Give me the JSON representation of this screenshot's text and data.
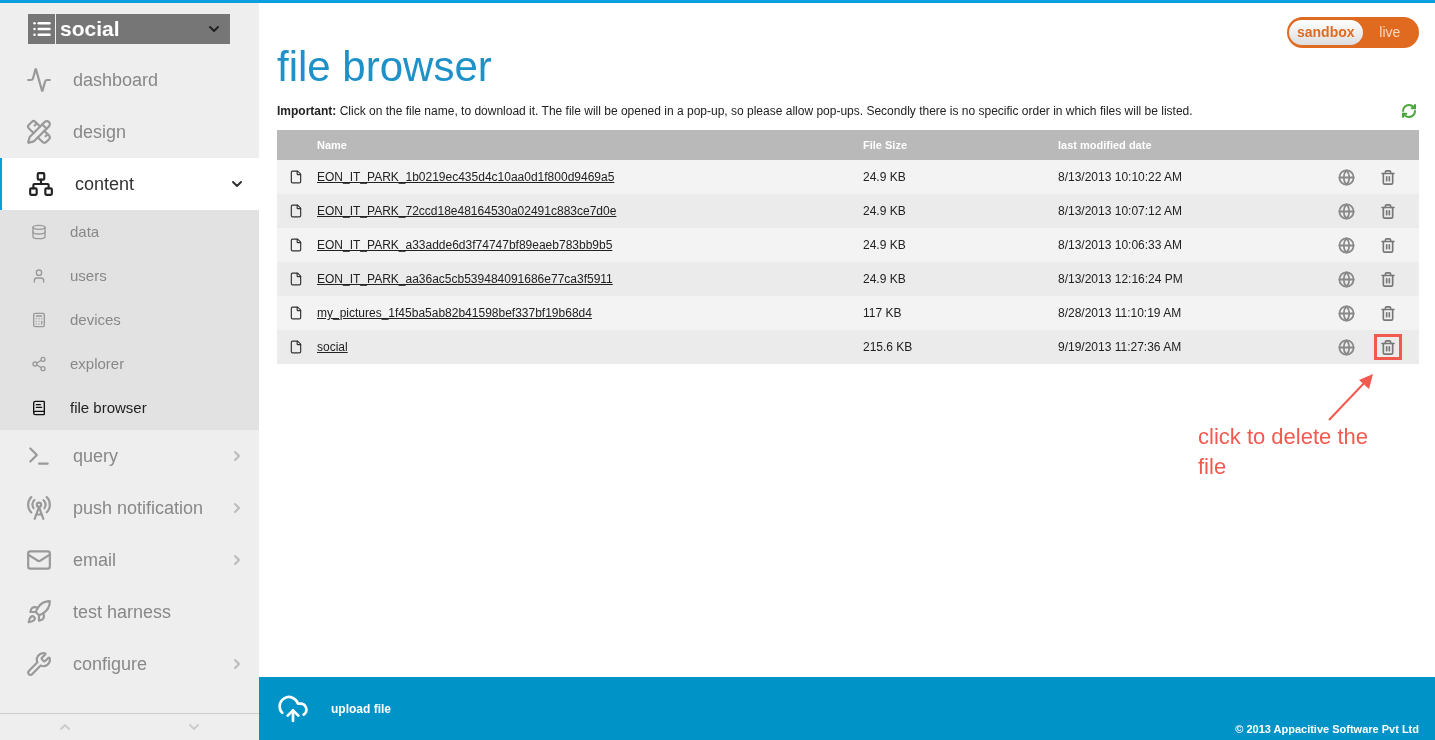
{
  "app_selector": {
    "label": "social"
  },
  "env_toggle": [
    {
      "label": "sandbox",
      "selected": true
    },
    {
      "label": "live",
      "selected": false
    }
  ],
  "sidebar": {
    "items": [
      {
        "label": "dashboard",
        "selected": false
      },
      {
        "label": "design",
        "selected": false
      },
      {
        "label": "content",
        "selected": true,
        "expanded": true,
        "children": [
          {
            "label": "data",
            "selected": false
          },
          {
            "label": "users",
            "selected": false
          },
          {
            "label": "devices",
            "selected": false
          },
          {
            "label": "explorer",
            "selected": false
          },
          {
            "label": "file browser",
            "selected": true
          }
        ]
      },
      {
        "label": "query",
        "selected": false,
        "expanded": false
      },
      {
        "label": "push notification",
        "selected": false,
        "expanded": false
      },
      {
        "label": "email",
        "selected": false,
        "expanded": false
      },
      {
        "label": "test harness",
        "selected": false
      },
      {
        "label": "configure",
        "selected": false,
        "expanded": false
      }
    ]
  },
  "page": {
    "title": "file browser",
    "notice": "**Important:** Click on the file name, to download it. The file will be opened in a pop-up, so please allow pop-ups. Secondly there is no specific order in which files will be listed."
  },
  "table": {
    "columns": [
      "Name",
      "File Size",
      "last modified date"
    ],
    "rows": [
      {
        "name": "EON_IT_PARK_1b0219ec435d4c10aa0d1f800d9469a5",
        "size": "24.9 KB",
        "date": "8/13/2013 10:10:22 AM",
        "highlighted": false
      },
      {
        "name": "EON_IT_PARK_72ccd18e48164530a02491c883ce7d0e",
        "size": "24.9 KB",
        "date": "8/13/2013 10:07:12 AM",
        "highlighted": false
      },
      {
        "name": "EON_IT_PARK_a33adde6d3f74747bf89eaeb783bb9b5",
        "size": "24.9 KB",
        "date": "8/13/2013 10:06:33 AM",
        "highlighted": false
      },
      {
        "name": "EON_IT_PARK_aa36ac5cb539484091686e77ca3f5911",
        "size": "24.9 KB",
        "date": "8/13/2013 12:16:24 PM",
        "highlighted": false
      },
      {
        "name": "my_pictures_1f45ba5ab82b41598bef337bf19b68d4",
        "size": "117 KB",
        "date": "8/28/2013 11:10:19 AM",
        "highlighted": false
      },
      {
        "name": "social",
        "size": "215.6 KB",
        "date": "9/19/2013 11:27:36 AM",
        "highlighted": true
      }
    ]
  },
  "annotation": {
    "text": "click to delete the file"
  },
  "footer": {
    "upload": "upload file",
    "copyright": "© 2013 Appacitive Software Pvt Ltd"
  }
}
